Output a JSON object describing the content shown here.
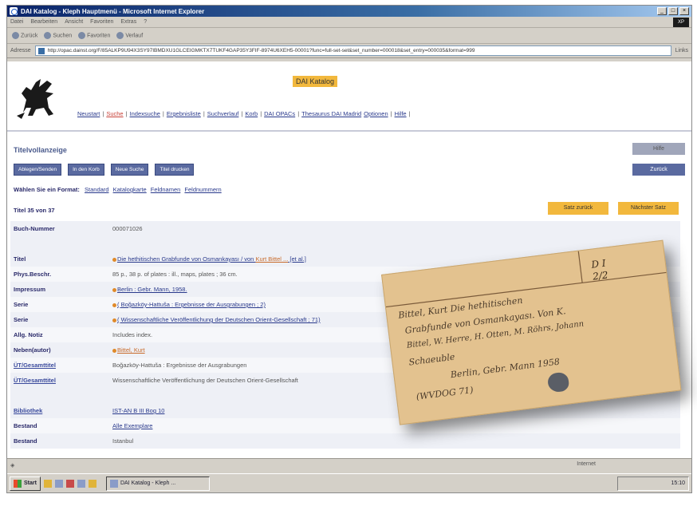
{
  "window": {
    "title": "DAI Katalog - Kleph Hauptmenü - Microsoft Internet Explorer",
    "controls": [
      "_",
      "□",
      "×"
    ]
  },
  "menubar": {
    "items": [
      "Datei",
      "Bearbeiten",
      "Ansicht",
      "Favoriten",
      "Extras",
      "?"
    ],
    "brand": "XP"
  },
  "toolbar": {
    "items": [
      "Zurück",
      "Suchen",
      "Favoriten",
      "Verlauf"
    ]
  },
  "addressbar": {
    "label": "Adresse",
    "url": "http://opac.dainst.org/F/85ALKP9U94X3SY97IBMDXU1GLCEIGMKTX7TUKF4GAP35Y3FIF-8974U6XEH5-00001?func=full-set-set&set_number=000018&set_entry=000035&format=999",
    "links_label": "Links"
  },
  "catalog": {
    "title": "DAI Katalog",
    "nav": [
      {
        "label": "Neustart",
        "active": false
      },
      {
        "label": "Suche",
        "active": true
      },
      {
        "label": "Indexsuche",
        "active": false
      },
      {
        "label": "Ergebnisliste",
        "active": false
      },
      {
        "label": "Suchverlauf",
        "active": false
      },
      {
        "label": "Korb",
        "active": false
      },
      {
        "label": "DAI OPACs",
        "active": false
      },
      {
        "label": "Thesaurus DAI Madrid",
        "active": false
      },
      {
        "label": "Optionen",
        "active": false
      },
      {
        "label": "Hilfe",
        "active": false
      }
    ]
  },
  "record": {
    "page_title": "Titelvollanzeige",
    "action_buttons": [
      "Ablegen/Senden",
      "In den Korb",
      "Neue Suche",
      "Titel drucken"
    ],
    "help_button": "Hilfe",
    "back_button": "Zurück",
    "format_label": "Wählen Sie ein Format:",
    "formats": [
      "Standard",
      "Katalogkarte",
      "Feldnamen",
      "Feldnummern"
    ],
    "count": "Titel 35 von 37",
    "prev_button": "Satz zurück",
    "next_button": "Nächster Satz",
    "fields": [
      {
        "label": "Buch-Nummer",
        "value": "000071026",
        "link": false
      },
      {
        "label": "",
        "value": "",
        "link": false
      },
      {
        "label": "Titel",
        "value": "Die hethitischen Grabfunde von Osmankayası / von ",
        "author": "Kurt Bittel ...",
        "suffix": " [et al.]",
        "link": true
      },
      {
        "label": "Phys.Beschr.",
        "value": "85 p., 38 p. of plates : ill., maps, plates ; 36 cm.",
        "link": false
      },
      {
        "label": "Impressum",
        "value": "Berlin : Gebr. Mann, 1958.",
        "link": true
      },
      {
        "label": "Serie",
        "value": "( Boğazköy-Hattuša : Ergebnisse der Ausgrabungen ; 2)",
        "link": true
      },
      {
        "label": "Serie",
        "value": "( Wissenschaftliche Veröffentlichung der Deutschen Orient-Gesellschaft ; 71)",
        "link": true
      },
      {
        "label": "Allg. Notiz",
        "value": "Includes index.",
        "link": false
      },
      {
        "label": "Neben(autor)",
        "value": "Bittel, Kurt",
        "link": true,
        "orange": true
      },
      {
        "label": "ÜT/Gesamttitel",
        "value": "Boğazköy-Hattuša : Ergebnisse der Ausgrabungen",
        "link": false,
        "label_link": true
      },
      {
        "label": "ÜT/Gesamttitel",
        "value": "Wissenschaftliche Veröffentlichung der Deutschen Orient-Gesellschaft",
        "link": false,
        "label_link": true
      },
      {
        "label": "",
        "value": "",
        "link": false
      },
      {
        "label": "Bibliothek",
        "value": "IST-AN B III Bog 10",
        "link": true,
        "label_link": true
      },
      {
        "label": "Bestand",
        "value": "Alle Exemplare",
        "link": true
      },
      {
        "label": "Bestand",
        "value": "Istanbul",
        "link": false
      }
    ]
  },
  "status": {
    "zone": "Internet"
  },
  "taskbar": {
    "start": "Start",
    "task": "DAI Katalog - Kleph ...",
    "clock": "15:10"
  },
  "card": {
    "call_number_1": "D I",
    "call_number_2": "2/2",
    "line1": "Bittel, Kurt       Die hethitischen",
    "line2": "Grabfunde von Osmankayası. Von K.",
    "line3": "Bittel, W. Herre, H. Otten, M. Röhrs, Johann",
    "line4": "Schaeuble",
    "line5": "Berlin, Gebr. Mann 1958",
    "line6": "(WVDOG 71)"
  }
}
